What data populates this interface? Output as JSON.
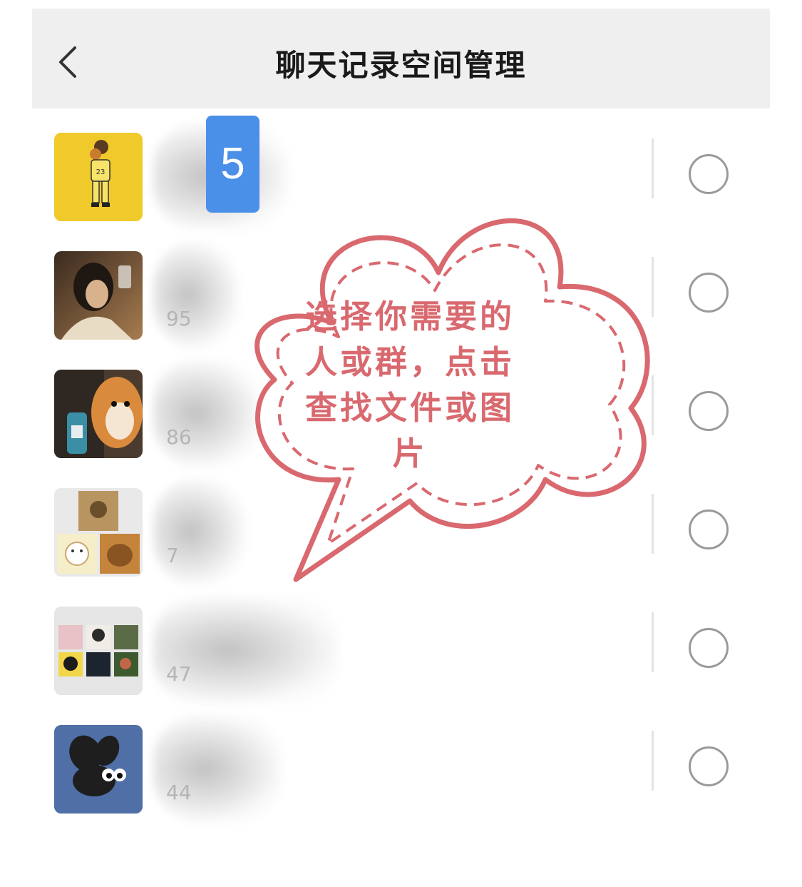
{
  "header": {
    "title": "聊天记录空间管理",
    "back_icon": "chevron-left-icon"
  },
  "step_badge": "5",
  "callout": {
    "text": "选择你需要的人或群，点击查找文件或图片",
    "color": "#d9696f"
  },
  "rows": [
    {
      "size_fragment": ""
    },
    {
      "size_fragment": "95"
    },
    {
      "size_fragment": "86"
    },
    {
      "size_fragment": "7"
    },
    {
      "size_fragment": "47"
    },
    {
      "size_fragment": "44"
    }
  ],
  "colors": {
    "header_bg": "#efefef",
    "badge": "#4a90e8",
    "radio_border": "#9a9a9a"
  }
}
